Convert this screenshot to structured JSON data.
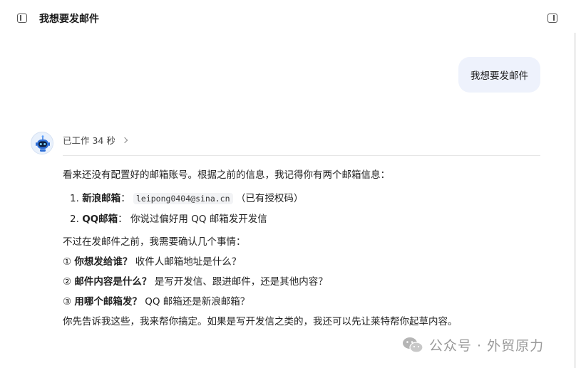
{
  "header": {
    "title": "我想要发邮件"
  },
  "user_message": {
    "text": "我想要发邮件"
  },
  "assistant": {
    "worked_label": "已工作 34 秒",
    "intro": "看来还没有配置好的邮箱账号。根据之前的信息，我记得你有两个邮箱信息：",
    "mailboxes": [
      {
        "num": "1.",
        "name": "新浪邮箱",
        "sep": "：",
        "code": "leipong0404@sina.cn",
        "note": "（已有授权码）"
      },
      {
        "num": "2.",
        "name": "QQ邮箱",
        "sep": "：",
        "note": "你说过偏好用 QQ 邮箱发开发信"
      }
    ],
    "confirm_intro": "不过在发邮件之前，我需要确认几个事情：",
    "questions": [
      {
        "mark": "①",
        "title": "你想发给谁？",
        "detail": "收件人邮箱地址是什么？"
      },
      {
        "mark": "②",
        "title": "邮件内容是什么？",
        "detail": "是写开发信、跟进邮件，还是其他内容？"
      },
      {
        "mark": "③",
        "title": "用哪个邮箱发？",
        "detail": "QQ 邮箱还是新浪邮箱？"
      }
    ],
    "closing": "你先告诉我这些，我来帮你搞定。如果是写开发信之类的，我还可以先让莱特帮你起草内容。"
  },
  "watermark": {
    "text": "公众号 · 外贸原力"
  },
  "colors": {
    "user_bubble_bg": "#eef2fc",
    "divider": "#e6e6e6",
    "avatar_accent": "#2f6fd6"
  },
  "icons": [
    "sidebar-toggle-icon",
    "panel-toggle-icon",
    "chevron-right-icon",
    "robot-avatar",
    "wechat-icon"
  ]
}
